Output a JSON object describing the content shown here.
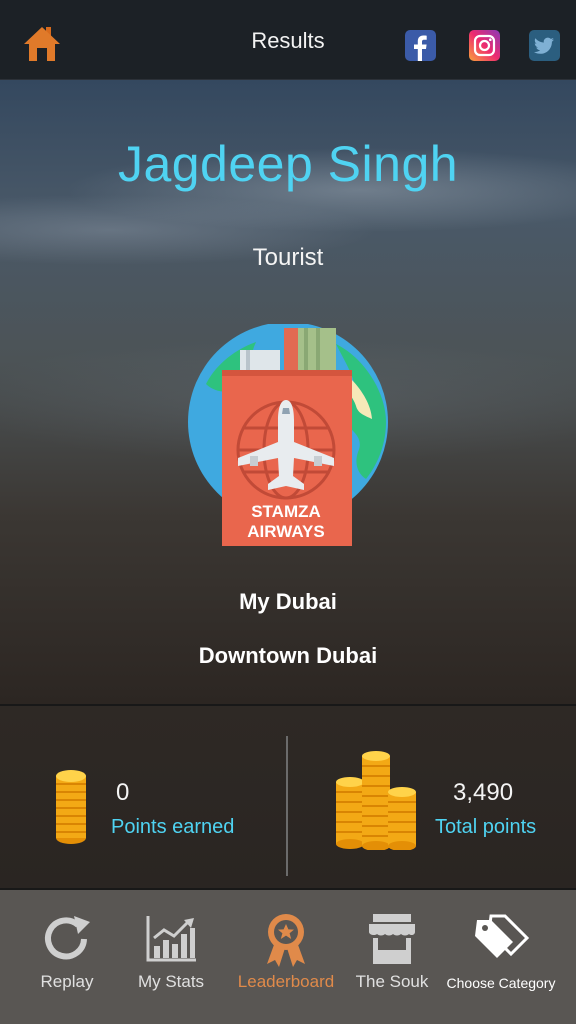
{
  "header": {
    "title": "Results",
    "icons": [
      "home-icon",
      "facebook-icon",
      "instagram-icon",
      "twitter-icon"
    ],
    "home_color": "#e07a2a"
  },
  "profile": {
    "name": "Jagdeep Singh",
    "rank": "Tourist",
    "badge_text_line1": "STAMZA",
    "badge_text_line2": "AIRWAYS",
    "category": "My Dubai",
    "subcategory": "Downtown Dubai",
    "name_color": "#4fd3f2"
  },
  "stats": {
    "earned": {
      "value": "0",
      "label": "Points earned"
    },
    "total": {
      "value": "3,490",
      "label": "Total points"
    },
    "label_color": "#4fd3f2"
  },
  "nav": {
    "items": [
      {
        "label": "Replay",
        "icon": "replay-icon"
      },
      {
        "label": "My Stats",
        "icon": "chart-icon"
      },
      {
        "label": "Leaderboard",
        "icon": "award-icon",
        "active": true
      },
      {
        "label": "The Souk",
        "icon": "shop-icon"
      },
      {
        "label": "Choose Category",
        "icon": "tags-icon"
      }
    ],
    "active_color": "#e08a4a"
  }
}
